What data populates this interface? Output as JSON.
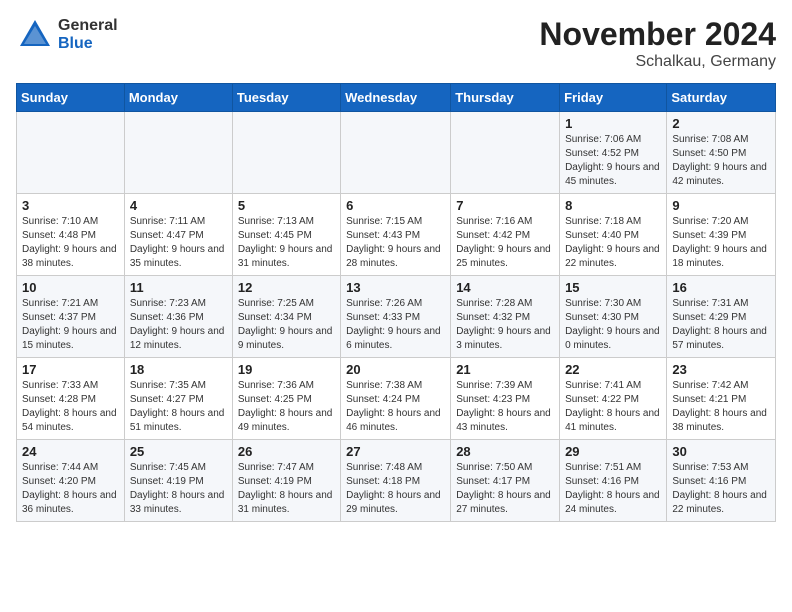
{
  "header": {
    "logo_general": "General",
    "logo_blue": "Blue",
    "title": "November 2024",
    "subtitle": "Schalkau, Germany"
  },
  "weekdays": [
    "Sunday",
    "Monday",
    "Tuesday",
    "Wednesday",
    "Thursday",
    "Friday",
    "Saturday"
  ],
  "weeks": [
    [
      {
        "day": "",
        "info": ""
      },
      {
        "day": "",
        "info": ""
      },
      {
        "day": "",
        "info": ""
      },
      {
        "day": "",
        "info": ""
      },
      {
        "day": "",
        "info": ""
      },
      {
        "day": "1",
        "info": "Sunrise: 7:06 AM\nSunset: 4:52 PM\nDaylight: 9 hours and 45 minutes."
      },
      {
        "day": "2",
        "info": "Sunrise: 7:08 AM\nSunset: 4:50 PM\nDaylight: 9 hours and 42 minutes."
      }
    ],
    [
      {
        "day": "3",
        "info": "Sunrise: 7:10 AM\nSunset: 4:48 PM\nDaylight: 9 hours and 38 minutes."
      },
      {
        "day": "4",
        "info": "Sunrise: 7:11 AM\nSunset: 4:47 PM\nDaylight: 9 hours and 35 minutes."
      },
      {
        "day": "5",
        "info": "Sunrise: 7:13 AM\nSunset: 4:45 PM\nDaylight: 9 hours and 31 minutes."
      },
      {
        "day": "6",
        "info": "Sunrise: 7:15 AM\nSunset: 4:43 PM\nDaylight: 9 hours and 28 minutes."
      },
      {
        "day": "7",
        "info": "Sunrise: 7:16 AM\nSunset: 4:42 PM\nDaylight: 9 hours and 25 minutes."
      },
      {
        "day": "8",
        "info": "Sunrise: 7:18 AM\nSunset: 4:40 PM\nDaylight: 9 hours and 22 minutes."
      },
      {
        "day": "9",
        "info": "Sunrise: 7:20 AM\nSunset: 4:39 PM\nDaylight: 9 hours and 18 minutes."
      }
    ],
    [
      {
        "day": "10",
        "info": "Sunrise: 7:21 AM\nSunset: 4:37 PM\nDaylight: 9 hours and 15 minutes."
      },
      {
        "day": "11",
        "info": "Sunrise: 7:23 AM\nSunset: 4:36 PM\nDaylight: 9 hours and 12 minutes."
      },
      {
        "day": "12",
        "info": "Sunrise: 7:25 AM\nSunset: 4:34 PM\nDaylight: 9 hours and 9 minutes."
      },
      {
        "day": "13",
        "info": "Sunrise: 7:26 AM\nSunset: 4:33 PM\nDaylight: 9 hours and 6 minutes."
      },
      {
        "day": "14",
        "info": "Sunrise: 7:28 AM\nSunset: 4:32 PM\nDaylight: 9 hours and 3 minutes."
      },
      {
        "day": "15",
        "info": "Sunrise: 7:30 AM\nSunset: 4:30 PM\nDaylight: 9 hours and 0 minutes."
      },
      {
        "day": "16",
        "info": "Sunrise: 7:31 AM\nSunset: 4:29 PM\nDaylight: 8 hours and 57 minutes."
      }
    ],
    [
      {
        "day": "17",
        "info": "Sunrise: 7:33 AM\nSunset: 4:28 PM\nDaylight: 8 hours and 54 minutes."
      },
      {
        "day": "18",
        "info": "Sunrise: 7:35 AM\nSunset: 4:27 PM\nDaylight: 8 hours and 51 minutes."
      },
      {
        "day": "19",
        "info": "Sunrise: 7:36 AM\nSunset: 4:25 PM\nDaylight: 8 hours and 49 minutes."
      },
      {
        "day": "20",
        "info": "Sunrise: 7:38 AM\nSunset: 4:24 PM\nDaylight: 8 hours and 46 minutes."
      },
      {
        "day": "21",
        "info": "Sunrise: 7:39 AM\nSunset: 4:23 PM\nDaylight: 8 hours and 43 minutes."
      },
      {
        "day": "22",
        "info": "Sunrise: 7:41 AM\nSunset: 4:22 PM\nDaylight: 8 hours and 41 minutes."
      },
      {
        "day": "23",
        "info": "Sunrise: 7:42 AM\nSunset: 4:21 PM\nDaylight: 8 hours and 38 minutes."
      }
    ],
    [
      {
        "day": "24",
        "info": "Sunrise: 7:44 AM\nSunset: 4:20 PM\nDaylight: 8 hours and 36 minutes."
      },
      {
        "day": "25",
        "info": "Sunrise: 7:45 AM\nSunset: 4:19 PM\nDaylight: 8 hours and 33 minutes."
      },
      {
        "day": "26",
        "info": "Sunrise: 7:47 AM\nSunset: 4:19 PM\nDaylight: 8 hours and 31 minutes."
      },
      {
        "day": "27",
        "info": "Sunrise: 7:48 AM\nSunset: 4:18 PM\nDaylight: 8 hours and 29 minutes."
      },
      {
        "day": "28",
        "info": "Sunrise: 7:50 AM\nSunset: 4:17 PM\nDaylight: 8 hours and 27 minutes."
      },
      {
        "day": "29",
        "info": "Sunrise: 7:51 AM\nSunset: 4:16 PM\nDaylight: 8 hours and 24 minutes."
      },
      {
        "day": "30",
        "info": "Sunrise: 7:53 AM\nSunset: 4:16 PM\nDaylight: 8 hours and 22 minutes."
      }
    ]
  ]
}
